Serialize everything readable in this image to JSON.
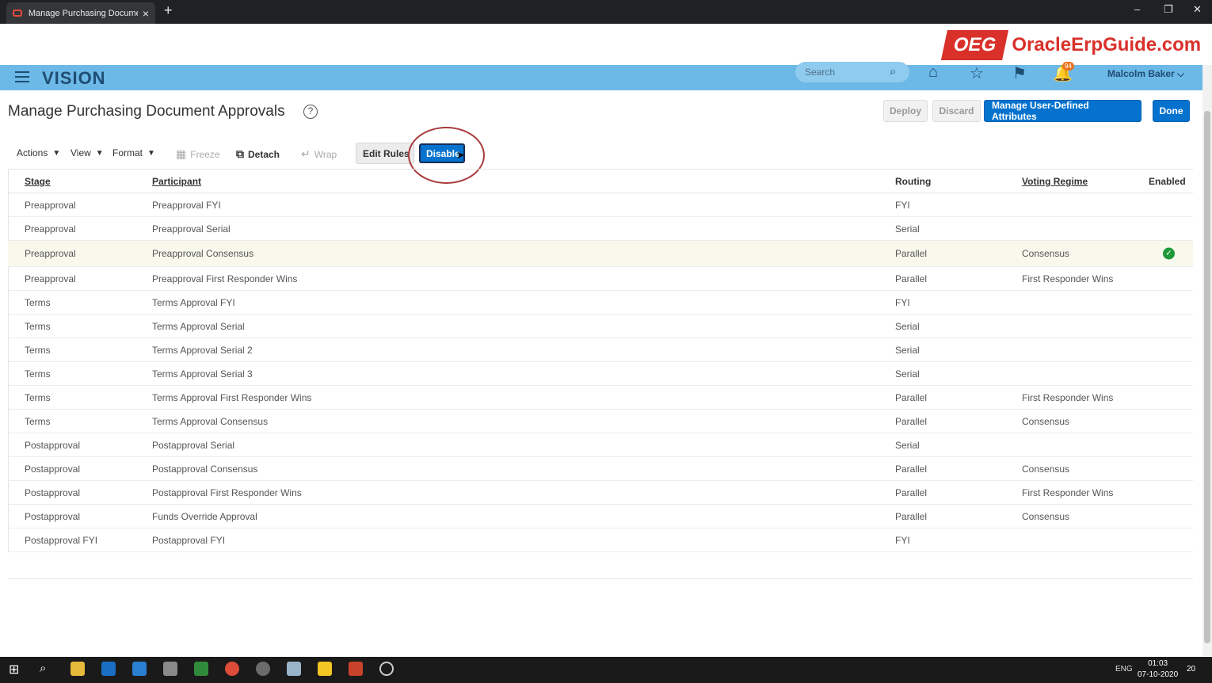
{
  "browser": {
    "tab_title": "Manage Purchasing Document A",
    "tab_close": "×",
    "new_tab": "+",
    "window_controls": [
      "–",
      "❐",
      "✕"
    ]
  },
  "logo": {
    "badge": "OEG",
    "site": "OracleErpGuide.com"
  },
  "header": {
    "brand": "VISION",
    "search_placeholder": "Search",
    "notification_count": "94",
    "user_name": "Malcolm Baker ⌵"
  },
  "page": {
    "title": "Manage Purchasing Document Approvals",
    "help": "?",
    "buttons": {
      "deploy": "Deploy",
      "discard": "Discard",
      "manage_attrs": "Manage User-Defined Attributes",
      "done": "Done"
    }
  },
  "toolbar": {
    "actions": "Actions",
    "view": "View",
    "format": "Format",
    "freeze": "Freeze",
    "detach": "Detach",
    "wrap": "Wrap",
    "edit_rules": "Edit Rules",
    "disable": "Disable"
  },
  "table": {
    "columns": {
      "stage": "Stage",
      "participant": "Participant",
      "routing": "Routing",
      "voting": "Voting Regime",
      "enabled": "Enabled"
    },
    "rows": [
      {
        "stage": "Preapproval",
        "participant": "Preapproval FYI",
        "routing": "FYI",
        "voting": "",
        "enabled": false
      },
      {
        "stage": "Preapproval",
        "participant": "Preapproval Serial",
        "routing": "Serial",
        "voting": "",
        "enabled": false
      },
      {
        "stage": "Preapproval",
        "participant": "Preapproval Consensus",
        "routing": "Parallel",
        "voting": "Consensus",
        "enabled": true
      },
      {
        "stage": "Preapproval",
        "participant": "Preapproval First Responder Wins",
        "routing": "Parallel",
        "voting": "First Responder Wins",
        "enabled": false
      },
      {
        "stage": "Terms",
        "participant": "Terms Approval FYI",
        "routing": "FYI",
        "voting": "",
        "enabled": false
      },
      {
        "stage": "Terms",
        "participant": "Terms Approval Serial",
        "routing": "Serial",
        "voting": "",
        "enabled": false
      },
      {
        "stage": "Terms",
        "participant": "Terms Approval Serial 2",
        "routing": "Serial",
        "voting": "",
        "enabled": false
      },
      {
        "stage": "Terms",
        "participant": "Terms Approval Serial 3",
        "routing": "Serial",
        "voting": "",
        "enabled": false
      },
      {
        "stage": "Terms",
        "participant": "Terms Approval First Responder Wins",
        "routing": "Parallel",
        "voting": "First Responder Wins",
        "enabled": false
      },
      {
        "stage": "Terms",
        "participant": "Terms Approval Consensus",
        "routing": "Parallel",
        "voting": "Consensus",
        "enabled": false
      },
      {
        "stage": "Postapproval",
        "participant": "Postapproval Serial",
        "routing": "Serial",
        "voting": "",
        "enabled": false
      },
      {
        "stage": "Postapproval",
        "participant": "Postapproval Consensus",
        "routing": "Parallel",
        "voting": "Consensus",
        "enabled": false
      },
      {
        "stage": "Postapproval",
        "participant": "Postapproval First Responder Wins",
        "routing": "Parallel",
        "voting": "First Responder Wins",
        "enabled": false
      },
      {
        "stage": "Postapproval",
        "participant": "Funds Override Approval",
        "routing": "Parallel",
        "voting": "Consensus",
        "enabled": false
      },
      {
        "stage": "Postapproval FYI",
        "participant": "Postapproval FYI",
        "routing": "FYI",
        "voting": "",
        "enabled": false
      }
    ]
  },
  "taskbar": {
    "tray_lang": "ENG",
    "time": "01:03",
    "date": "07-10-2020",
    "notif_count": "20"
  },
  "colors": {
    "app_header": "#6cb8e6",
    "brand_text": "#1e4c73",
    "primary_button": "#0572ce",
    "enabled_check": "#1f9a3a",
    "annotation_circle": "#a93a3c"
  }
}
